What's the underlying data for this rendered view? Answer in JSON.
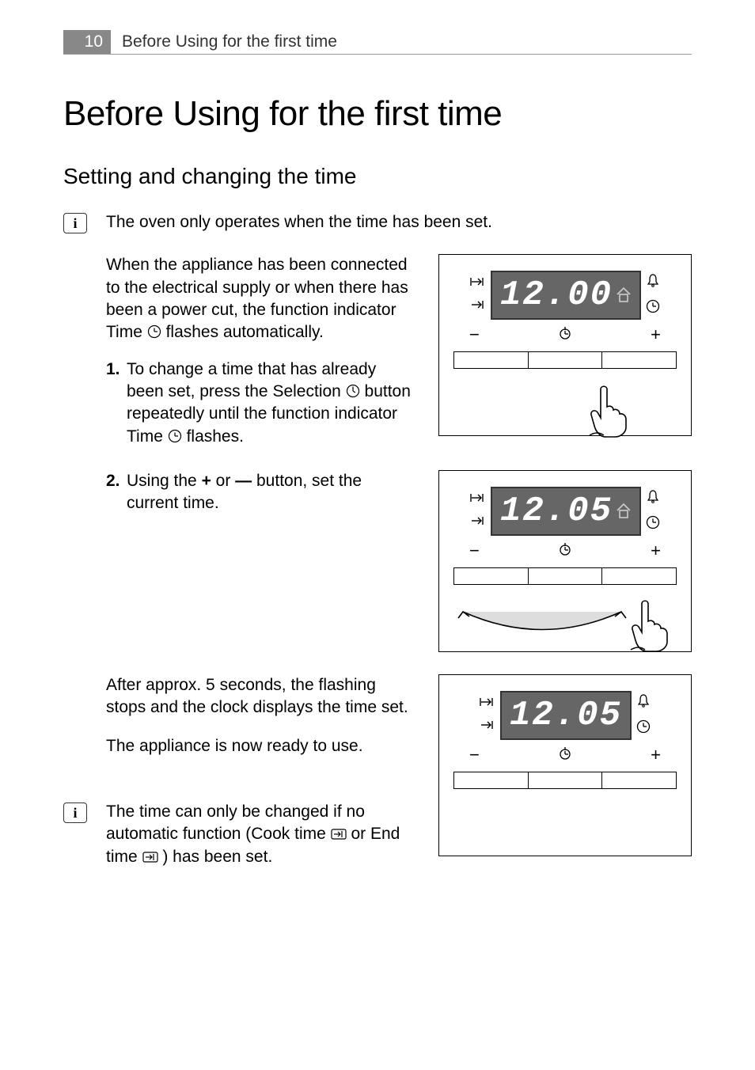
{
  "header": {
    "page_number": "10",
    "running_title": "Before Using for the first time"
  },
  "h1": "Before Using for the first time",
  "h2": "Setting and changing the time",
  "info1": "The oven only operates when the time has been set.",
  "para_connect": "When the appliance has been connected to the electrical supply or when there has been a power cut, the function indicator Time ",
  "para_connect_tail": " flashes automatically.",
  "step1_num": "1.",
  "step1_a": "To change a time that has already been set, press the Selection ",
  "step1_b": " button repeatedly until the function indicator Time ",
  "step1_c": " flashes.",
  "step2_num": "2.",
  "step2_a": "Using the ",
  "step2_b": " or ",
  "step2_c": " button, set the current time.",
  "para_after": "After approx. 5 seconds, the flashing stops and the clock displays the time set.",
  "para_ready": "The appliance is now ready to use.",
  "info2_a": "The time can only be changed if no automatic function (Cook time ",
  "info2_b": " or End time ",
  "info2_c": ") has been set.",
  "glyphs": {
    "clock_circle": "ⓘ",
    "selection": "ⓘ",
    "plus": "+",
    "minus": "—",
    "cook_time": "⇥",
    "end_time": "⇥"
  },
  "figures": {
    "f1": {
      "digits": "12.00"
    },
    "f2": {
      "digits": "12.05"
    },
    "f3": {
      "digits": "12.05"
    }
  },
  "icon_syms": {
    "cooktime": "⇥",
    "endtime": "→|",
    "bell": "⬡",
    "clock_plus": "⊕",
    "minus": "−",
    "selection_btn": "Ⓘ",
    "plus": "+"
  }
}
